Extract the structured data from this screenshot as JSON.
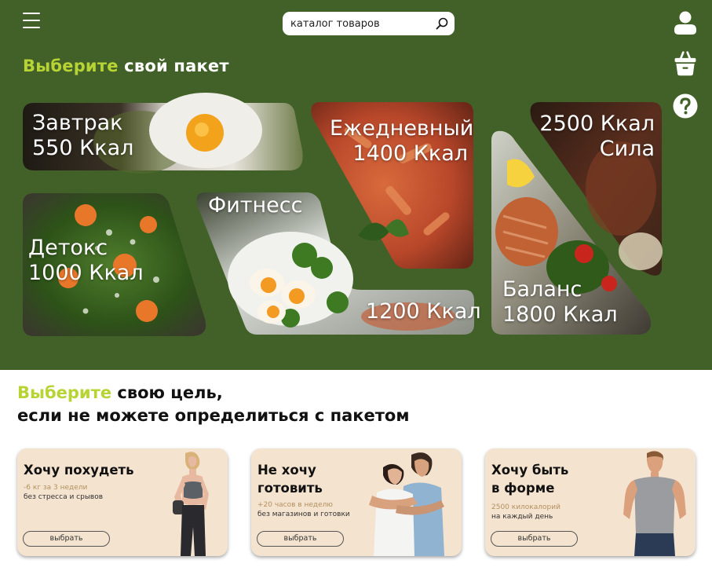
{
  "header": {
    "search_placeholder": "каталог товаров",
    "icons": [
      "menu-icon",
      "search-icon",
      "user-icon",
      "basket-icon",
      "help-icon"
    ]
  },
  "packages": {
    "title_accent": "Выберите",
    "title_rest": " свой пакет",
    "cards": [
      {
        "line1": "Завтрак",
        "line2": "550 Ккал"
      },
      {
        "line1": "Ежедневный",
        "line2": "1400 Ккал"
      },
      {
        "line1": "2500 Ккал",
        "line2": "Сила"
      },
      {
        "line1": "Детокс",
        "line2": "1000 Ккал"
      },
      {
        "line1": "Фитнесс",
        "line2": "1200 Ккал"
      },
      {
        "line1": "Баланс",
        "line2": "1800 Ккал"
      }
    ]
  },
  "goals": {
    "title_accent": "Выберите",
    "title_rest": " свою цель,",
    "title_line2": "если не можете определиться с пакетом",
    "cards": [
      {
        "title": "Хочу похудеть",
        "line1": "-6 кг за 3 недели",
        "line2": "без стресса и срывов",
        "button": "выбрать"
      },
      {
        "title": "Не хочу\nготовить",
        "line1": "+20 часов в неделю",
        "line2": "без магазинов и готовки",
        "button": "выбрать"
      },
      {
        "title": "Хочу быть\nв форме",
        "line1": "2500 килокалорий",
        "line2": "на каждый день",
        "button": "выбрать"
      }
    ]
  },
  "colors": {
    "hero_background": "#426128",
    "accent": "#b7d334",
    "goal_card_background": "#f4e3cf"
  }
}
